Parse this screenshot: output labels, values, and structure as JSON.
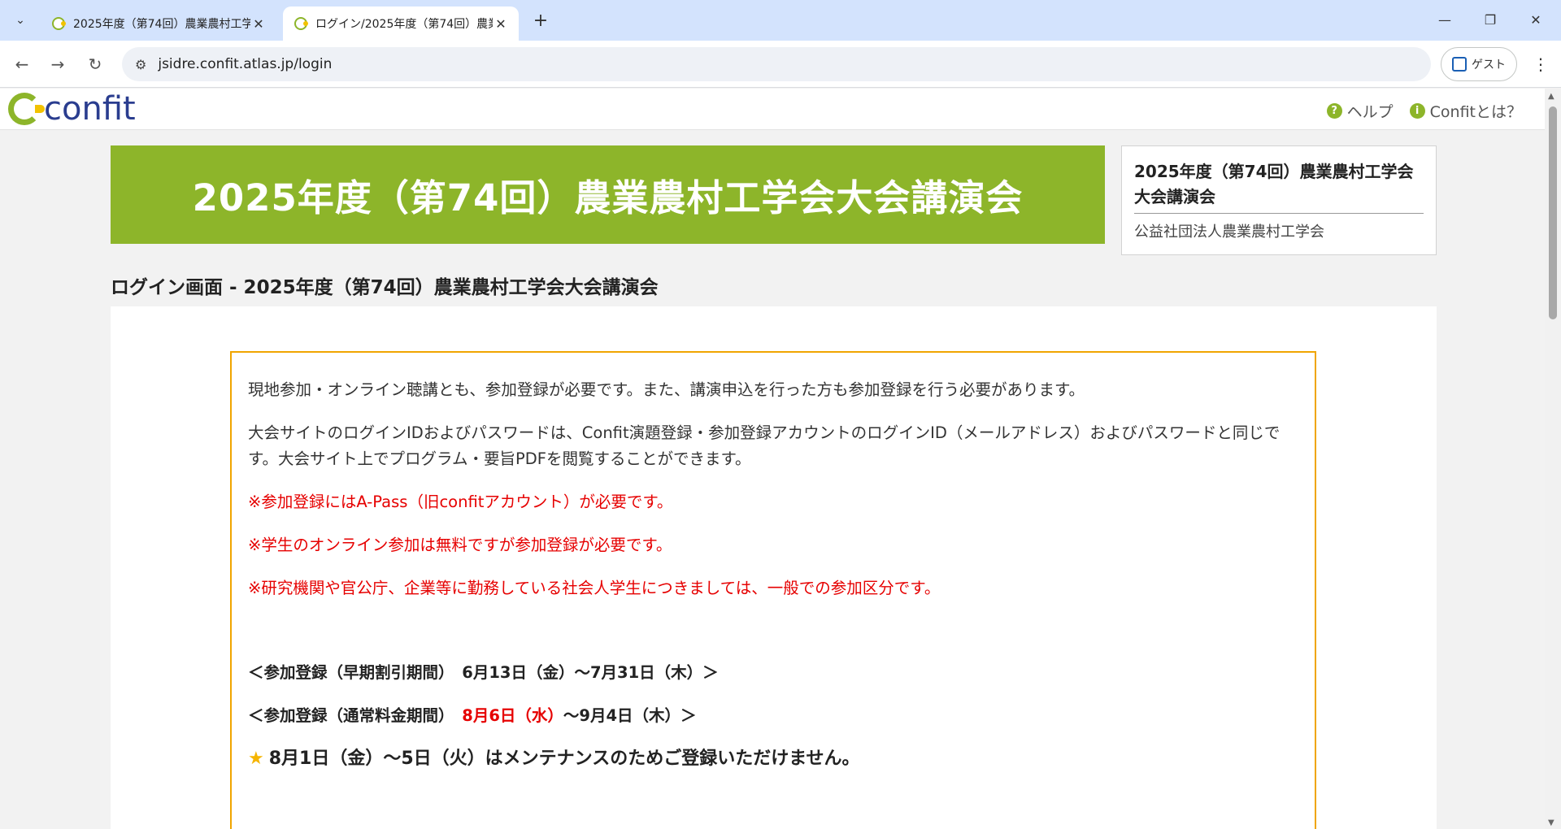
{
  "browser": {
    "tabs": [
      {
        "title": "2025年度（第74回）農業農村工学",
        "active": false
      },
      {
        "title": "ログイン/2025年度（第74回）農業",
        "active": true
      }
    ],
    "url": "jsidre.confit.atlas.jp/login",
    "guest_label": "ゲスト"
  },
  "header": {
    "logo_text": "confit",
    "links": [
      {
        "label": "ヘルプ",
        "icon": "question-icon"
      },
      {
        "label": "Confitとは？",
        "icon": "info-icon"
      }
    ]
  },
  "banner": {
    "title": "2025年度（第74回）農業農村工学会大会講演会"
  },
  "infocard": {
    "title": "2025年度（第74回）農業農村工学会大会講演会",
    "organization": "公益社団法人農業農村工学会"
  },
  "page_heading": "ログイン画面 - 2025年度（第74回）農業農村工学会大会講演会",
  "notice": {
    "para1": "現地参加・オンライン聴講とも、参加登録が必要です。また、講演申込を行った方も参加登録を行う必要があります。",
    "para2": "大会サイトのログインIDおよびパスワードは、Confit演題登録・参加登録アカウントのログインID（メールアドレス）およびパスワードと同じです。大会サイト上でプログラム・要旨PDFを閲覧することができます。",
    "red1": "※参加登録にはA-Pass（旧confitアカウント）が必要です。",
    "red2": "※学生のオンライン参加は無料ですが参加登録が必要です。",
    "red3": "※研究機関や官公庁、企業等に勤務している社会人学生につきましては、一般での参加区分です。",
    "early": "＜参加登録（早期割引期間）　6月13日（金）〜7月31日（木）＞",
    "normal_prefix": "＜参加登録（通常料金期間）　",
    "normal_red": "8月6日（水）",
    "normal_suffix": "〜9月4日（木）＞",
    "maintenance": "8月1日（金）〜5日（火）はメンテナンスのためご登録いただけません。"
  },
  "colors": {
    "brand_green": "#8db52a",
    "notice_border": "#f0a500",
    "alert_red": "#e60000"
  }
}
